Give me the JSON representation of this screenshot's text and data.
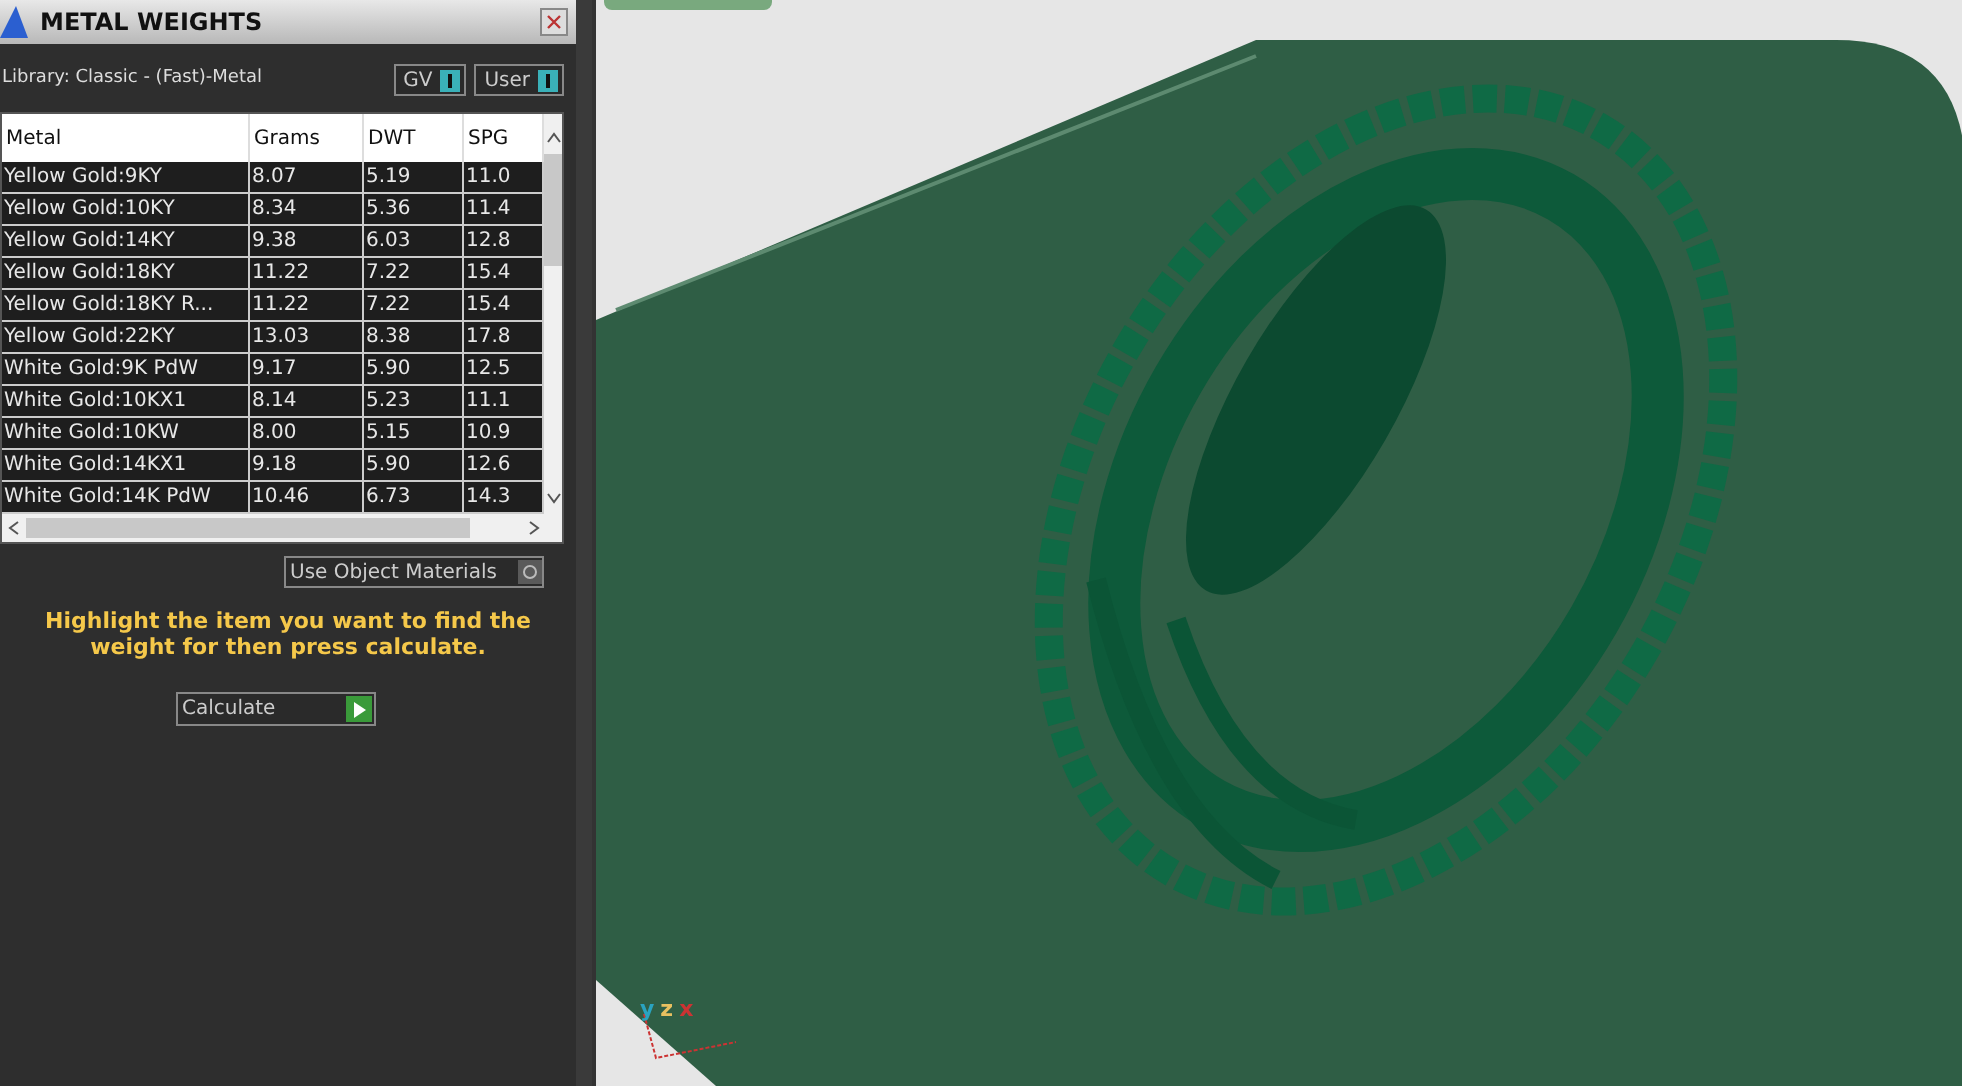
{
  "panel": {
    "title": "METAL WEIGHTS",
    "library": "Library: Classic - (Fast)-Metal",
    "toggles": [
      {
        "label": "GV",
        "on": true
      },
      {
        "label": "User",
        "on": true
      }
    ]
  },
  "table": {
    "columns": [
      "Metal",
      "Grams",
      "DWT",
      "SPG"
    ],
    "rows": [
      [
        "Yellow Gold:9KY",
        "8.07",
        "5.19",
        "11.0"
      ],
      [
        "Yellow Gold:10KY",
        "8.34",
        "5.36",
        "11.4"
      ],
      [
        "Yellow Gold:14KY",
        "9.38",
        "6.03",
        "12.8"
      ],
      [
        "Yellow Gold:18KY",
        "11.22",
        "7.22",
        "15.4"
      ],
      [
        "Yellow Gold:18KY R...",
        "11.22",
        "7.22",
        "15.4"
      ],
      [
        "Yellow Gold:22KY",
        "13.03",
        "8.38",
        "17.8"
      ],
      [
        "White Gold:9K PdW",
        "9.17",
        "5.90",
        "12.5"
      ],
      [
        "White Gold:10KX1",
        "8.14",
        "5.23",
        "11.1"
      ],
      [
        "White Gold:10KW",
        "8.00",
        "5.15",
        "10.9"
      ],
      [
        "White Gold:14KX1",
        "9.18",
        "5.90",
        "12.6"
      ],
      [
        "White Gold:14K PdW",
        "10.46",
        "6.73",
        "14.3"
      ]
    ]
  },
  "use_object_materials": {
    "label": "Use Object Materials"
  },
  "hint": "Highlight the item you want to find the weight for then press calculate.",
  "calculate_button": "Calculate",
  "viewport": {
    "axes": [
      "y",
      "z",
      "x"
    ]
  }
}
